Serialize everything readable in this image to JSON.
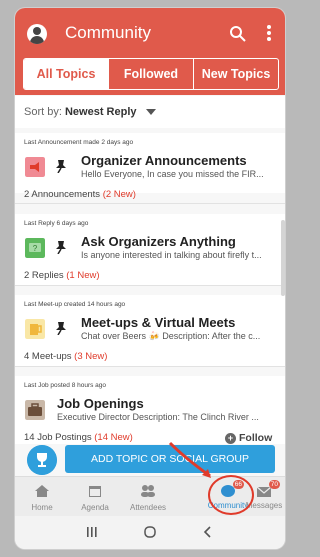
{
  "appbar": {
    "title": "Community"
  },
  "tabs": [
    {
      "label": "All Topics",
      "active": true
    },
    {
      "label": "Followed",
      "active": false
    },
    {
      "label": "New Topics",
      "active": false
    }
  ],
  "sort": {
    "prefix": "Sort by:",
    "value": "Newest Reply"
  },
  "cards": [
    {
      "meta": "Last Announcement made 2 days ago",
      "title": "Organizer Announcements",
      "subtitle": "Hello Everyone,   In case you missed the FIR...",
      "count": "2 Announcements",
      "new": "(2 New)",
      "icon_color": "#f08a94"
    },
    {
      "meta": "Last Reply 6 days ago",
      "title": "Ask Organizers Anything",
      "subtitle": "Is anyone interested in talking about firefly t...",
      "count": "2 Replies",
      "new": "(1 New)",
      "icon_color": "#5cb85c"
    },
    {
      "meta": "Last Meet-up created 14 hours ago",
      "title": "Meet-ups & Virtual Meets",
      "subtitle": "Chat over Beers 🍻  Description: After the c...",
      "count": "4 Meet-ups",
      "new": "(3 New)",
      "icon_color": "#f5d77a"
    },
    {
      "meta": "Last Job posted 8 hours ago",
      "title": "Job Openings",
      "subtitle": "Executive Director   Description: The Clinch River ...",
      "count": "14 Job Postings",
      "new": "(14 New)",
      "icon_color": "#8a6d5a"
    }
  ],
  "follow_label": "Follow",
  "fab_label": "ADD TOPIC OR SOCIAL GROUP",
  "nav": [
    {
      "label": "Home",
      "badge": ""
    },
    {
      "label": "Agenda",
      "badge": ""
    },
    {
      "label": "Attendees",
      "badge": ""
    },
    {
      "label": "Community",
      "badge": "66"
    },
    {
      "label": "Messages",
      "badge": "70"
    }
  ],
  "colors": {
    "primary": "#e05a4b",
    "accent": "#2f9fdc",
    "new": "#e03b2b"
  }
}
